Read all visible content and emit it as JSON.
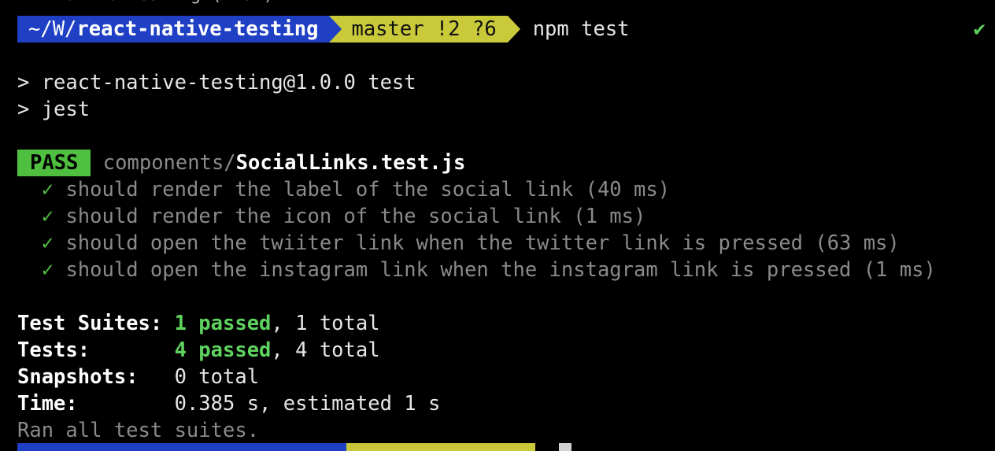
{
  "window": {
    "title_partial": "✕  native-testing (-zsh)"
  },
  "prompt": {
    "path_prefix": "~/W/",
    "path_last": "react-native-testing",
    "git_branch": "master !2 ?6",
    "command": "npm test",
    "status_icon": "✔"
  },
  "output": {
    "script_line1": "> react-native-testing@1.0.0 test",
    "script_line2": "> jest",
    "pass_badge": "PASS",
    "test_dir": "components/",
    "test_file": "SocialLinks.test.js",
    "check_glyph": "✓",
    "tests": [
      "should render the label of the social link (40 ms)",
      "should render the icon of the social link (1 ms)",
      "should open the twiiter link when the twitter link is pressed (63 ms)",
      "should open the instagram link when the instagram link is pressed (1 ms)"
    ]
  },
  "summary": {
    "suites_label": "Test Suites:",
    "suites_passed": "1 passed",
    "suites_total": ", 1 total",
    "tests_label": "Tests:",
    "tests_passed": "4 passed",
    "tests_total": ", 4 total",
    "snapshots_label": "Snapshots:",
    "snapshots_value": "0 total",
    "time_label": "Time:",
    "time_value": "0.385 s, estimated 1 s",
    "ran_all": "Ran all test suites."
  },
  "colors": {
    "background": "#000000",
    "path_segment": "#1f3fc4",
    "git_segment": "#c9c93a",
    "pass_green": "#4fbf3f",
    "success_text": "#5fd35f",
    "dim_text": "#8a8a8a"
  }
}
